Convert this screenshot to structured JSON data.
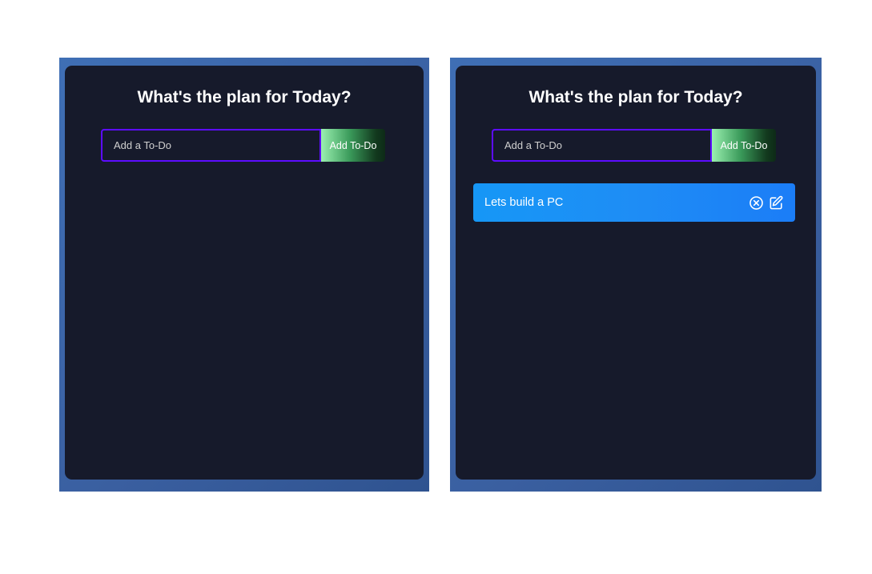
{
  "panels": [
    {
      "title": "What's the plan for Today?",
      "input_placeholder": "Add a To-Do",
      "input_value": "",
      "add_button_label": "Add To-Do",
      "todos": []
    },
    {
      "title": "What's the plan for Today?",
      "input_placeholder": "Add a To-Do",
      "input_value": "",
      "add_button_label": "Add To-Do",
      "todos": [
        {
          "text": "Lets build a PC",
          "delete_icon": "close-circle-icon",
          "edit_icon": "edit-icon"
        }
      ]
    }
  ],
  "colors": {
    "background": "#ffffff",
    "frame": "#3f6fb5",
    "card": "#161a2b",
    "input_border": "#5d0cff",
    "todo_row": "#1697f6"
  }
}
